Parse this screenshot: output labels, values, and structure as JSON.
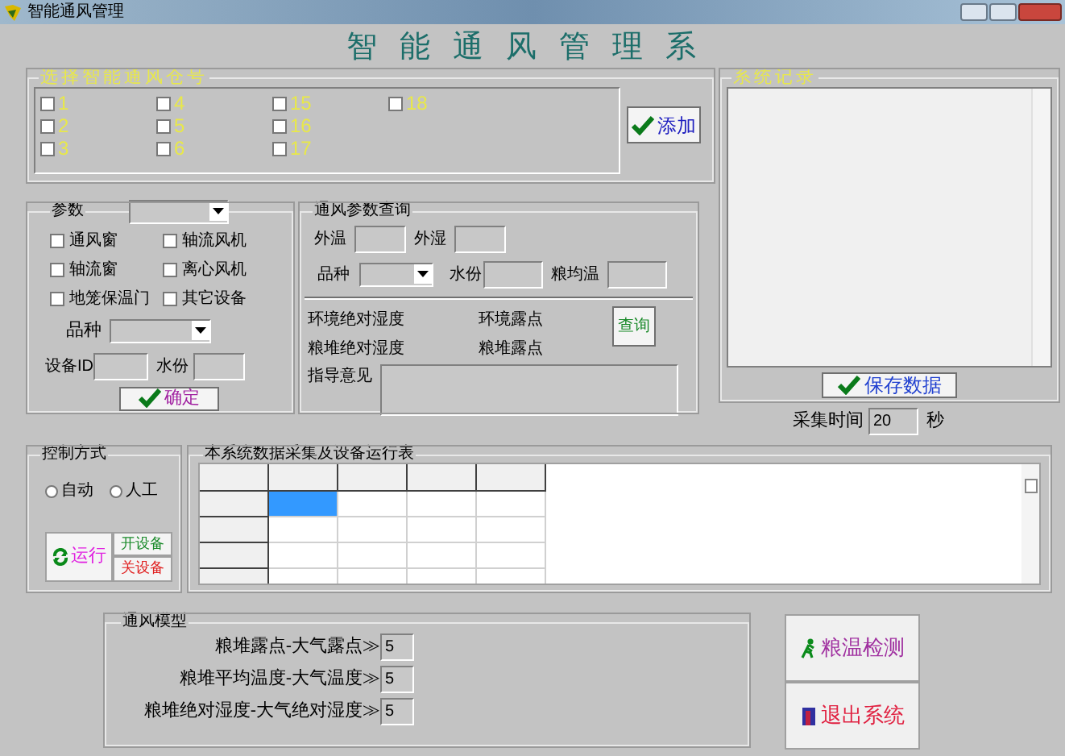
{
  "window": {
    "title": "智能通风管理"
  },
  "heading": "智能通风管理系",
  "bin_select": {
    "title": "选择智能通风仓号",
    "columns": [
      [
        {
          "label": "1",
          "checked": false
        },
        {
          "label": "2",
          "checked": false
        },
        {
          "label": "3",
          "checked": false
        }
      ],
      [
        {
          "label": "4",
          "checked": false
        },
        {
          "label": "5",
          "checked": false
        },
        {
          "label": "6",
          "checked": false
        }
      ],
      [
        {
          "label": "15",
          "checked": false
        },
        {
          "label": "16",
          "checked": false
        },
        {
          "label": "17",
          "checked": false
        }
      ],
      [
        {
          "label": "18",
          "checked": false
        }
      ]
    ],
    "add_button": "添加"
  },
  "system_log": {
    "title": "系统记录",
    "save_button": "保存数据",
    "interval_label": "采集时间",
    "interval_value": "20",
    "interval_unit": "秒"
  },
  "params": {
    "title": "参数",
    "devices": [
      {
        "label": "通风窗",
        "checked": false
      },
      {
        "label": "轴流风机",
        "checked": false
      },
      {
        "label": "轴流窗",
        "checked": false
      },
      {
        "label": "离心风机",
        "checked": false
      },
      {
        "label": "地笼保温门",
        "checked": false
      },
      {
        "label": "其它设备",
        "checked": false
      }
    ],
    "variety_label": "品种",
    "device_id_label": "设备ID",
    "moisture_label": "水份",
    "confirm_button": "确定"
  },
  "query": {
    "title": "通风参数查询",
    "outer_temp_label": "外温",
    "outer_humidity_label": "外湿",
    "variety_label": "品种",
    "moisture_label": "水份",
    "grain_avg_temp_label": "粮均温",
    "results": [
      "环境绝对湿度",
      "环境露点",
      "粮堆绝对湿度",
      "粮堆露点"
    ],
    "query_button": "查询",
    "advice_label": "指导意见"
  },
  "control": {
    "title": "控制方式",
    "modes": [
      {
        "label": "自动",
        "selected": false
      },
      {
        "label": "人工",
        "selected": false
      }
    ],
    "run_button": "运行",
    "start_button": "开设备",
    "stop_button": "关设备"
  },
  "table": {
    "title": "本系统数据采集及设备运行表",
    "rows": [
      {
        "cells": [
          {
            "selected": true
          },
          {
            "selected": false
          },
          {
            "selected": false
          },
          {
            "selected": false
          }
        ]
      },
      {
        "cells": [
          {
            "selected": false
          },
          {
            "selected": false
          },
          {
            "selected": false
          },
          {
            "selected": false
          }
        ]
      },
      {
        "cells": [
          {
            "selected": false
          },
          {
            "selected": false
          },
          {
            "selected": false
          },
          {
            "selected": false
          }
        ]
      },
      {
        "cells": [
          {
            "selected": false
          },
          {
            "selected": false
          },
          {
            "selected": false
          },
          {
            "selected": false
          }
        ]
      }
    ]
  },
  "model": {
    "title": "通风模型",
    "rows": [
      {
        "label": "粮堆露点-大气露点≫",
        "value": "5"
      },
      {
        "label": "粮堆平均温度-大气温度≫",
        "value": "5"
      },
      {
        "label": "粮堆绝对湿度-大气绝对湿度≫",
        "value": "5"
      }
    ]
  },
  "actions": {
    "detect_button": "粮温检测",
    "exit_button": "退出系统"
  }
}
